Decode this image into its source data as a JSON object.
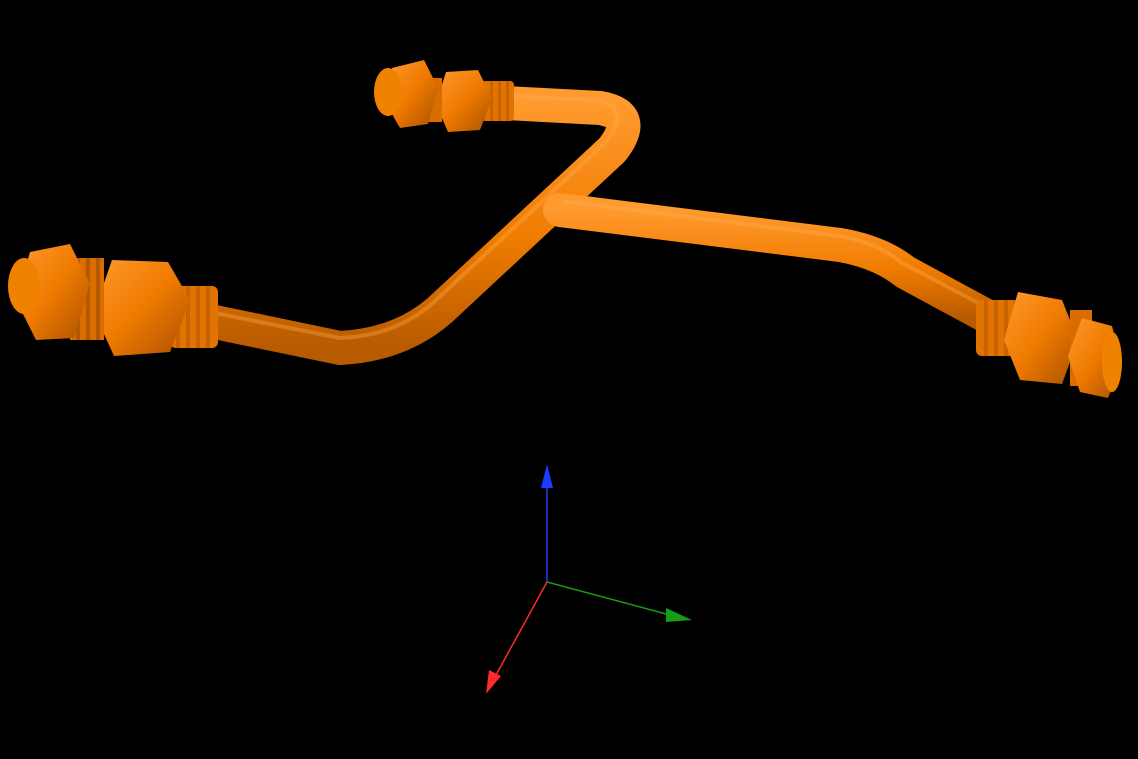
{
  "viewer": {
    "background_color": "#000000",
    "grid_color": "#bdbdbd",
    "grid_visible": true
  },
  "model": {
    "kind": "tee-pipe-assembly",
    "color": "#f07c00",
    "shade_color": "#b85a00",
    "highlight_color": "#ff9a2e",
    "fittings": [
      {
        "name": "top-fitting",
        "icon": "hex-nut-fitting"
      },
      {
        "name": "left-fitting",
        "icon": "hex-nut-fitting"
      },
      {
        "name": "right-fitting",
        "icon": "hex-nut-fitting"
      }
    ]
  },
  "axes_gizmo": {
    "x_axis_color": "#ff2a2a",
    "y_axis_color": "#169c16",
    "z_axis_color": "#1c3cff"
  }
}
